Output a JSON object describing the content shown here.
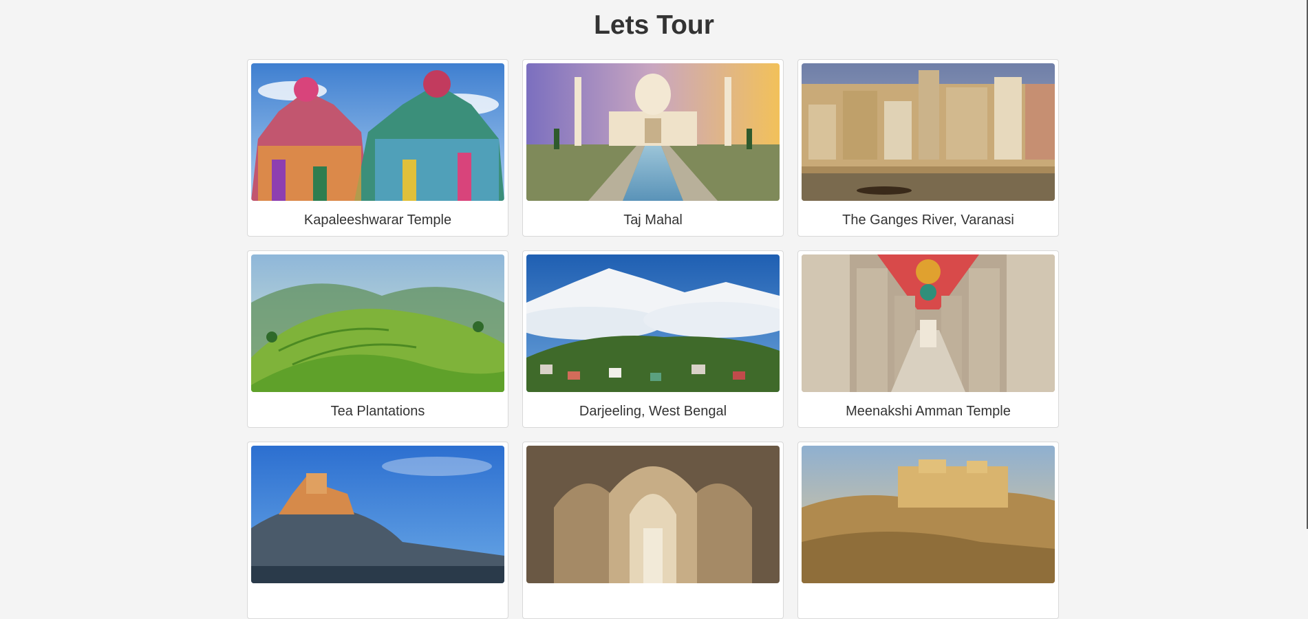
{
  "page": {
    "title": "Lets Tour"
  },
  "cards": [
    {
      "label": "Kapaleeshwarar Temple",
      "image": "colorful-temple-gopuram-image"
    },
    {
      "label": "Taj Mahal",
      "image": "taj-mahal-image"
    },
    {
      "label": "The Ganges River, Varanasi",
      "image": "varanasi-ghats-image"
    },
    {
      "label": "Tea Plantations",
      "image": "tea-plantation-hills-image"
    },
    {
      "label": "Darjeeling, West Bengal",
      "image": "himalaya-mountain-town-image"
    },
    {
      "label": "Meenakshi Amman Temple",
      "image": "temple-pillared-corridor-image"
    },
    {
      "label": "",
      "image": "hilltop-fort-image"
    },
    {
      "label": "",
      "image": "arched-palace-hall-image"
    },
    {
      "label": "",
      "image": "desert-fort-image"
    }
  ]
}
